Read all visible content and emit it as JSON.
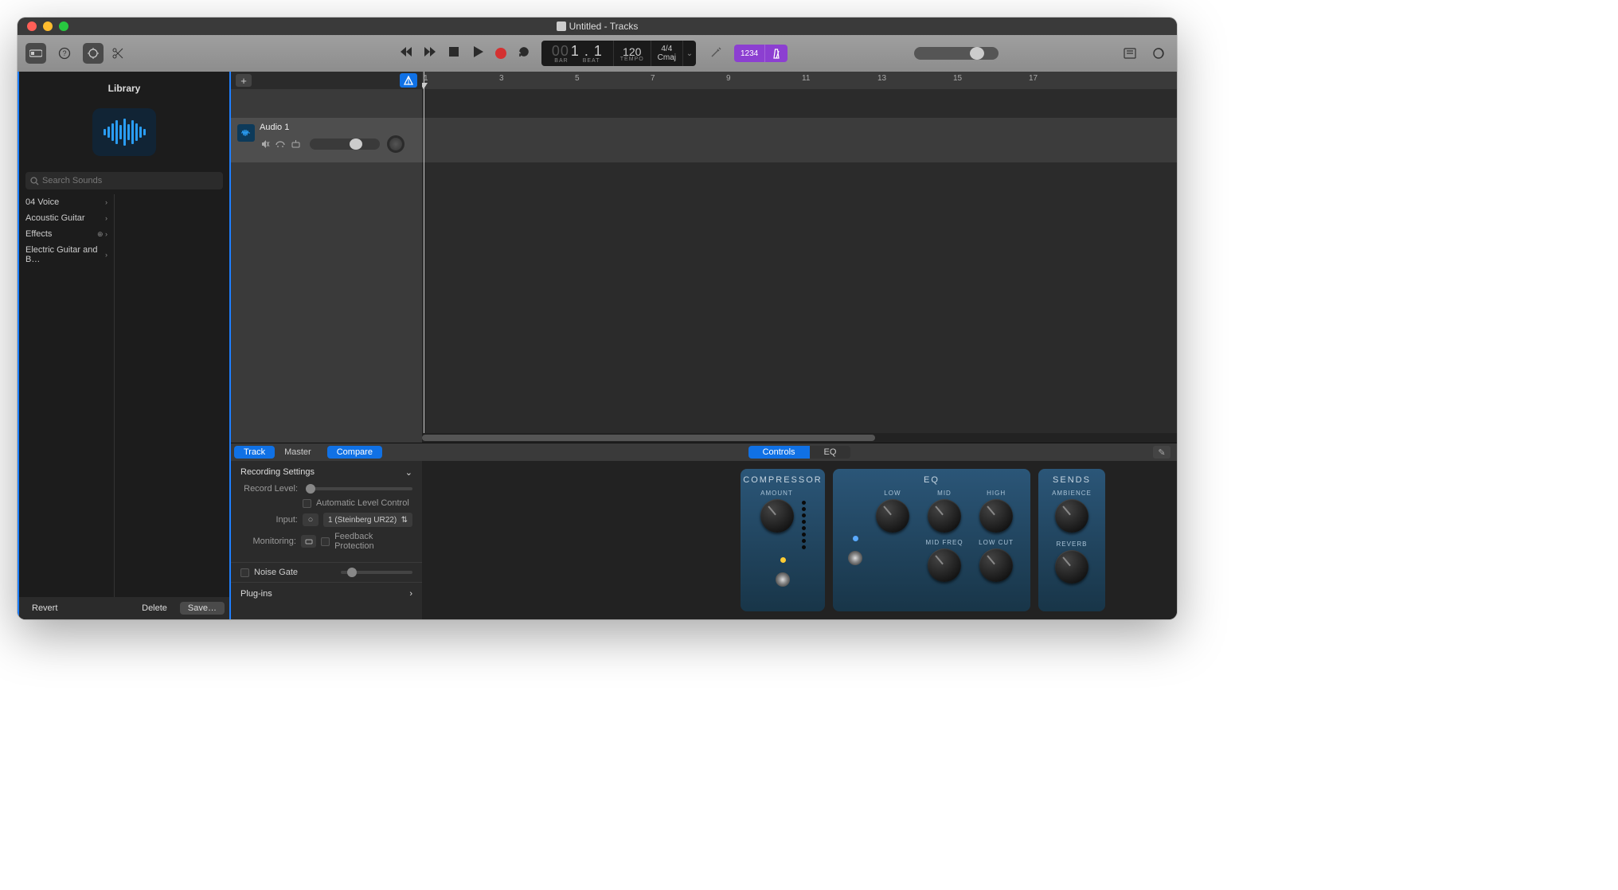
{
  "window": {
    "title": "Untitled - Tracks"
  },
  "lcd": {
    "bar_ghost": "00",
    "position": "1 . 1",
    "bar_label": "BAR",
    "beat_label": "BEAT",
    "tempo": "120",
    "tempo_label": "TEMPO",
    "sig": "4/4",
    "key": "Cmaj"
  },
  "badges": {
    "count": "1234"
  },
  "library": {
    "title": "Library",
    "search_placeholder": "Search Sounds",
    "categories": [
      {
        "name": "04 Voice",
        "icons": "chev"
      },
      {
        "name": "Acoustic Guitar",
        "icons": "chev"
      },
      {
        "name": "Effects",
        "icons": "dl-chev"
      },
      {
        "name": "Electric Guitar and B…",
        "icons": "chev"
      }
    ],
    "revert": "Revert",
    "delete": "Delete",
    "save": "Save…"
  },
  "track": {
    "name": "Audio 1"
  },
  "ruler_ticks": [
    "1",
    "3",
    "5",
    "7",
    "9",
    "11",
    "13",
    "15",
    "17"
  ],
  "smart": {
    "tab_track": "Track",
    "tab_master": "Master",
    "tab_compare": "Compare",
    "rec_settings": "Recording Settings",
    "record_level": "Record Level:",
    "auto_level": "Automatic Level Control",
    "input_label": "Input:",
    "input_value": "1  (Steinberg UR22)",
    "monitoring_label": "Monitoring:",
    "feedback": "Feedback Protection",
    "noise_gate": "Noise Gate",
    "plugins": "Plug-ins",
    "pill_controls": "Controls",
    "pill_eq": "EQ",
    "compressor": {
      "title": "COMPRESSOR",
      "amount": "AMOUNT"
    },
    "eq": {
      "title": "EQ",
      "low": "LOW",
      "mid": "MID",
      "high": "HIGH",
      "midfreq": "MID FREQ",
      "lowcut": "LOW CUT"
    },
    "sends": {
      "title": "SENDS",
      "ambience": "AMBIENCE",
      "reverb": "REVERB"
    }
  }
}
